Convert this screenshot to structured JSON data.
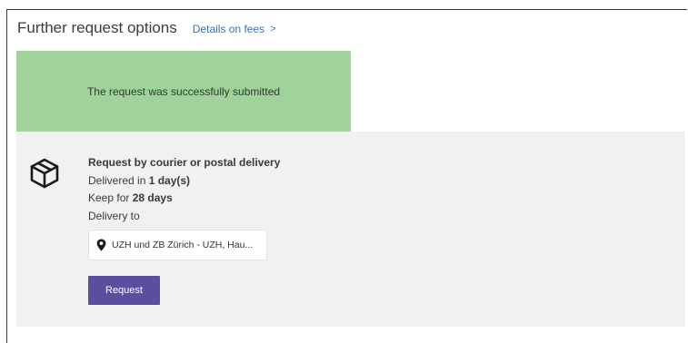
{
  "header": {
    "title": "Further request options",
    "fees_link": "Details on fees",
    "fees_chevron": ">"
  },
  "notice": {
    "message": "The request was successfully submitted",
    "color": "#9fd39a"
  },
  "option": {
    "icon": "package-box-icon",
    "title": "Request by courier or postal delivery",
    "delivered_prefix": "Delivered in ",
    "delivered_value": "1 day(s)",
    "keep_prefix": "Keep for ",
    "keep_value": "28 days",
    "delivery_label": "Delivery to",
    "location_icon": "map-pin-icon",
    "delivery_value": "UZH und ZB Zürich - UZH, Hau...",
    "request_label": "Request",
    "button_color": "#5b4e9e"
  }
}
